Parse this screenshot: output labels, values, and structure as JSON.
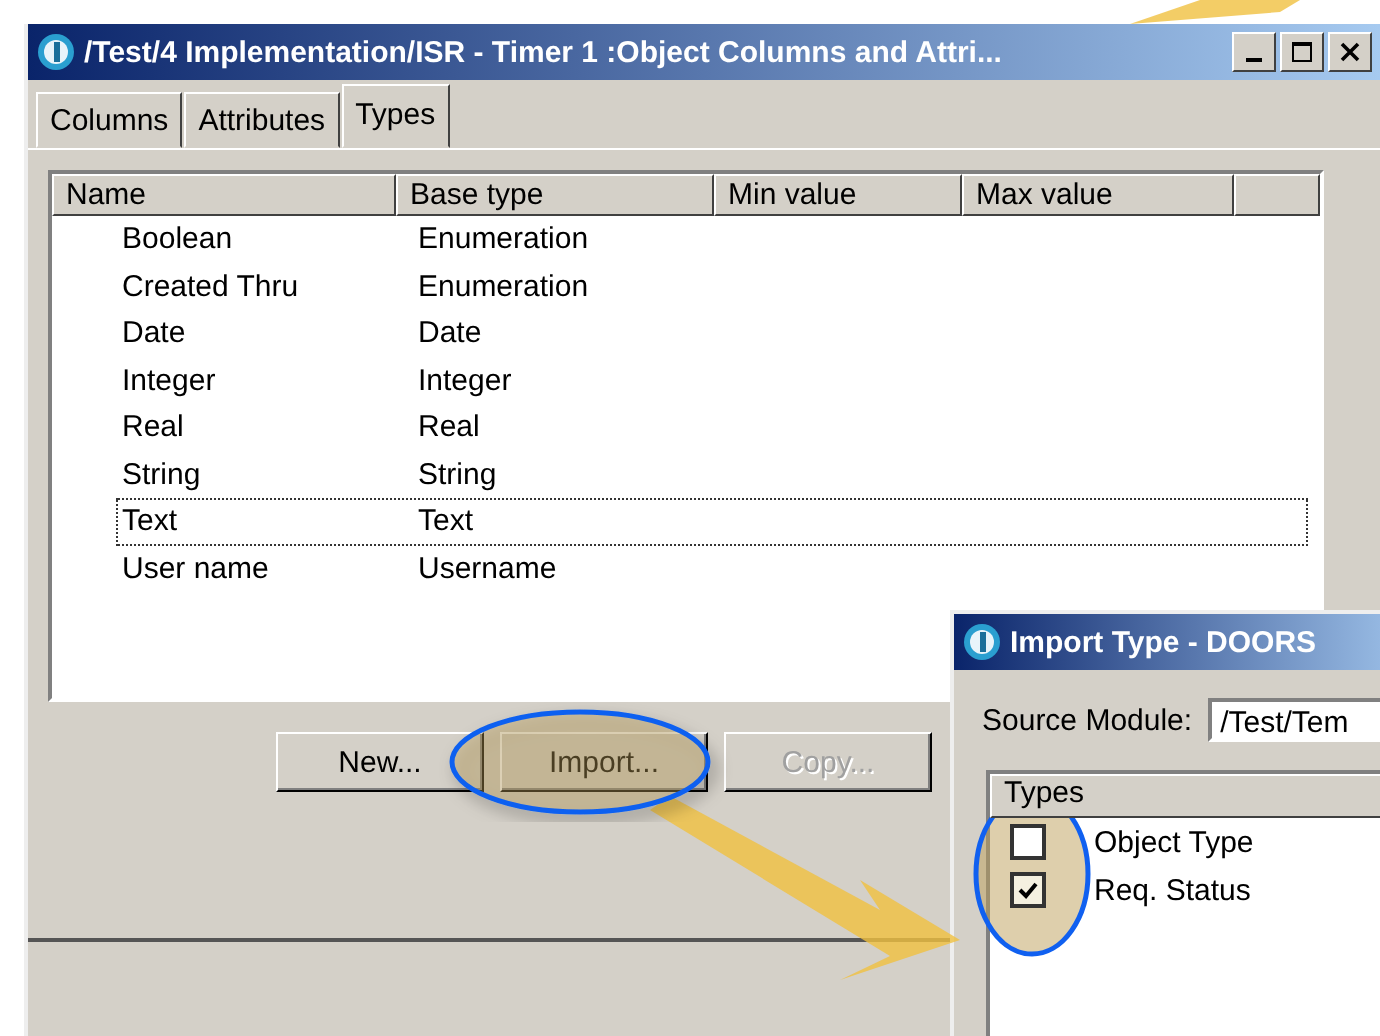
{
  "main_window": {
    "title": "/Test/4 Implementation/ISR - Timer 1 :Object  Columns and Attri..."
  },
  "tabs": [
    {
      "label": "Columns",
      "selected": false
    },
    {
      "label": "Attributes",
      "selected": false
    },
    {
      "label": "Types",
      "selected": true
    }
  ],
  "table": {
    "columns": [
      "Name",
      "Base type",
      "Min value",
      "Max value"
    ],
    "rows": [
      {
        "name": "Boolean",
        "base_type": "Enumeration",
        "focused": false
      },
      {
        "name": "Created Thru",
        "base_type": "Enumeration",
        "focused": false
      },
      {
        "name": "Date",
        "base_type": "Date",
        "focused": false
      },
      {
        "name": "Integer",
        "base_type": "Integer",
        "focused": false
      },
      {
        "name": "Real",
        "base_type": "Real",
        "focused": false
      },
      {
        "name": "String",
        "base_type": "String",
        "focused": false
      },
      {
        "name": "Text",
        "base_type": "Text",
        "focused": true
      },
      {
        "name": "User name",
        "base_type": "Username",
        "focused": false
      }
    ]
  },
  "buttons": [
    {
      "label": "New...",
      "disabled": false
    },
    {
      "label": "Import...",
      "disabled": false
    },
    {
      "label": "Copy...",
      "disabled": true
    }
  ],
  "import_dialog": {
    "title": "Import Type - DOORS",
    "source_module_label": "Source Module:",
    "source_module_value": "/Test/Tem",
    "list_header": "Types",
    "items": [
      {
        "label": "Object Type",
        "checked": false
      },
      {
        "label": "Req. Status",
        "checked": true
      }
    ]
  }
}
